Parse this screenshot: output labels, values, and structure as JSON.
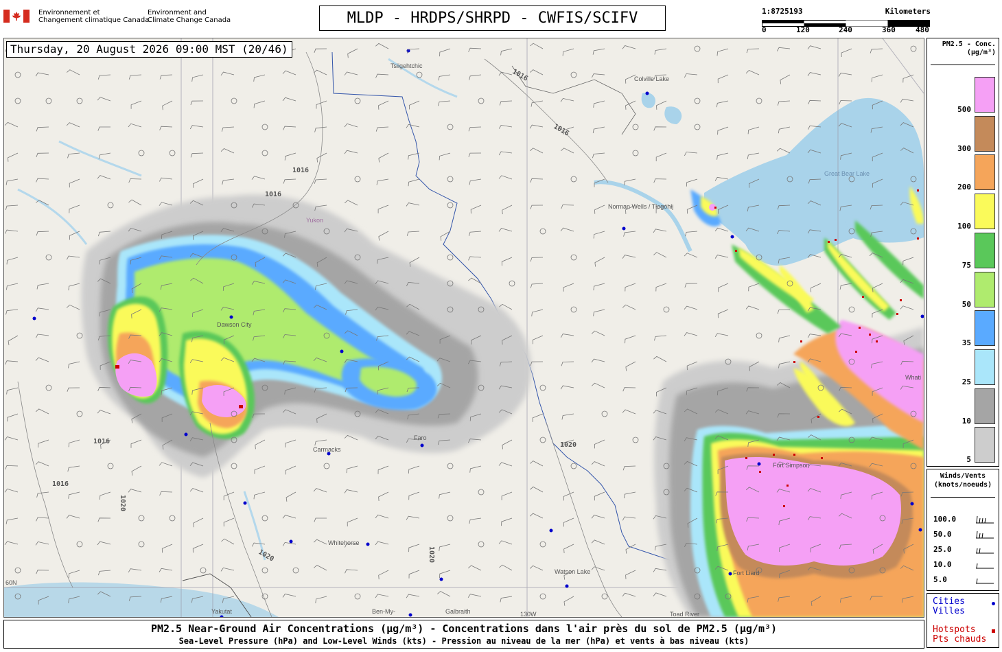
{
  "header": {
    "org_fr": [
      "Environnement et",
      "Changement climatique Canada"
    ],
    "org_en": [
      "Environment and",
      "Climate Change Canada"
    ],
    "title": "MLDP - HRDPS/SHRPD - CWFIS/SCIFV"
  },
  "scale": {
    "ratio": "1:8725193",
    "unit": "Kilometers",
    "ticks": [
      "0",
      "120",
      "240",
      "360",
      "480"
    ]
  },
  "timestamp": "Thursday, 20 August 2026 09:00 MST (20/46)",
  "legend": {
    "title": [
      "PM2.5 - Conc.",
      "(µg/m³)"
    ],
    "levels": [
      {
        "value": "500",
        "color": "#f5a0f5"
      },
      {
        "value": "300",
        "color": "#c48a5a"
      },
      {
        "value": "200",
        "color": "#f5a55a"
      },
      {
        "value": "100",
        "color": "#fafa5a"
      },
      {
        "value": "75",
        "color": "#5ac85a"
      },
      {
        "value": "50",
        "color": "#afeb6e"
      },
      {
        "value": "35",
        "color": "#5aaaff"
      },
      {
        "value": "25",
        "color": "#aae6fa"
      },
      {
        "value": "10",
        "color": "#a5a5a5"
      },
      {
        "value": "5",
        "color": "#cdcdcd"
      }
    ]
  },
  "winds": {
    "title": [
      "Winds/Vents",
      "(knots/noeuds)"
    ],
    "rows": [
      "100.0",
      "50.0",
      "25.0",
      "10.0",
      "5.0"
    ]
  },
  "key": {
    "cities": [
      "Cities",
      "Villes"
    ],
    "cities_color": "#0000cc",
    "hotspots": [
      "Hotspots",
      "Pts chauds"
    ],
    "hotspots_color": "#cc0000"
  },
  "footer": {
    "line1": "PM2.5 Near-Ground Air Concentrations (µg/m³) - Concentrations dans l'air près du sol de PM2.5 (µg/m³)",
    "line2": "Sea-Level Pressure (hPa) and Low-Level Winds (kts) - Pression au niveau de la mer (hPa) et vents à bas niveau (kts)"
  },
  "map": {
    "places": [
      {
        "name": "Tsiigehtchic"
      },
      {
        "name": "Colville Lake"
      },
      {
        "name": "Norman Wells / Tłegóhłį"
      },
      {
        "name": "Great Bear Lake"
      },
      {
        "name": "Yukon"
      },
      {
        "name": "Dawson City"
      },
      {
        "name": "Carmacks"
      },
      {
        "name": "Faro"
      },
      {
        "name": "Whitehorse"
      },
      {
        "name": "Watson Lake"
      },
      {
        "name": "Yakutat"
      },
      {
        "name": "Ben-My-"
      },
      {
        "name": "Galbraith"
      },
      {
        "name": "Toad River"
      },
      {
        "name": "Whati"
      },
      {
        "name": "Fort Simpson"
      },
      {
        "name": "Fort Liard"
      },
      {
        "name": "130W"
      },
      {
        "name": "60N"
      }
    ],
    "isobars": [
      "1016",
      "1020"
    ],
    "colors": {
      "land": "#f0eee8",
      "water": "#a9d3ea"
    }
  }
}
